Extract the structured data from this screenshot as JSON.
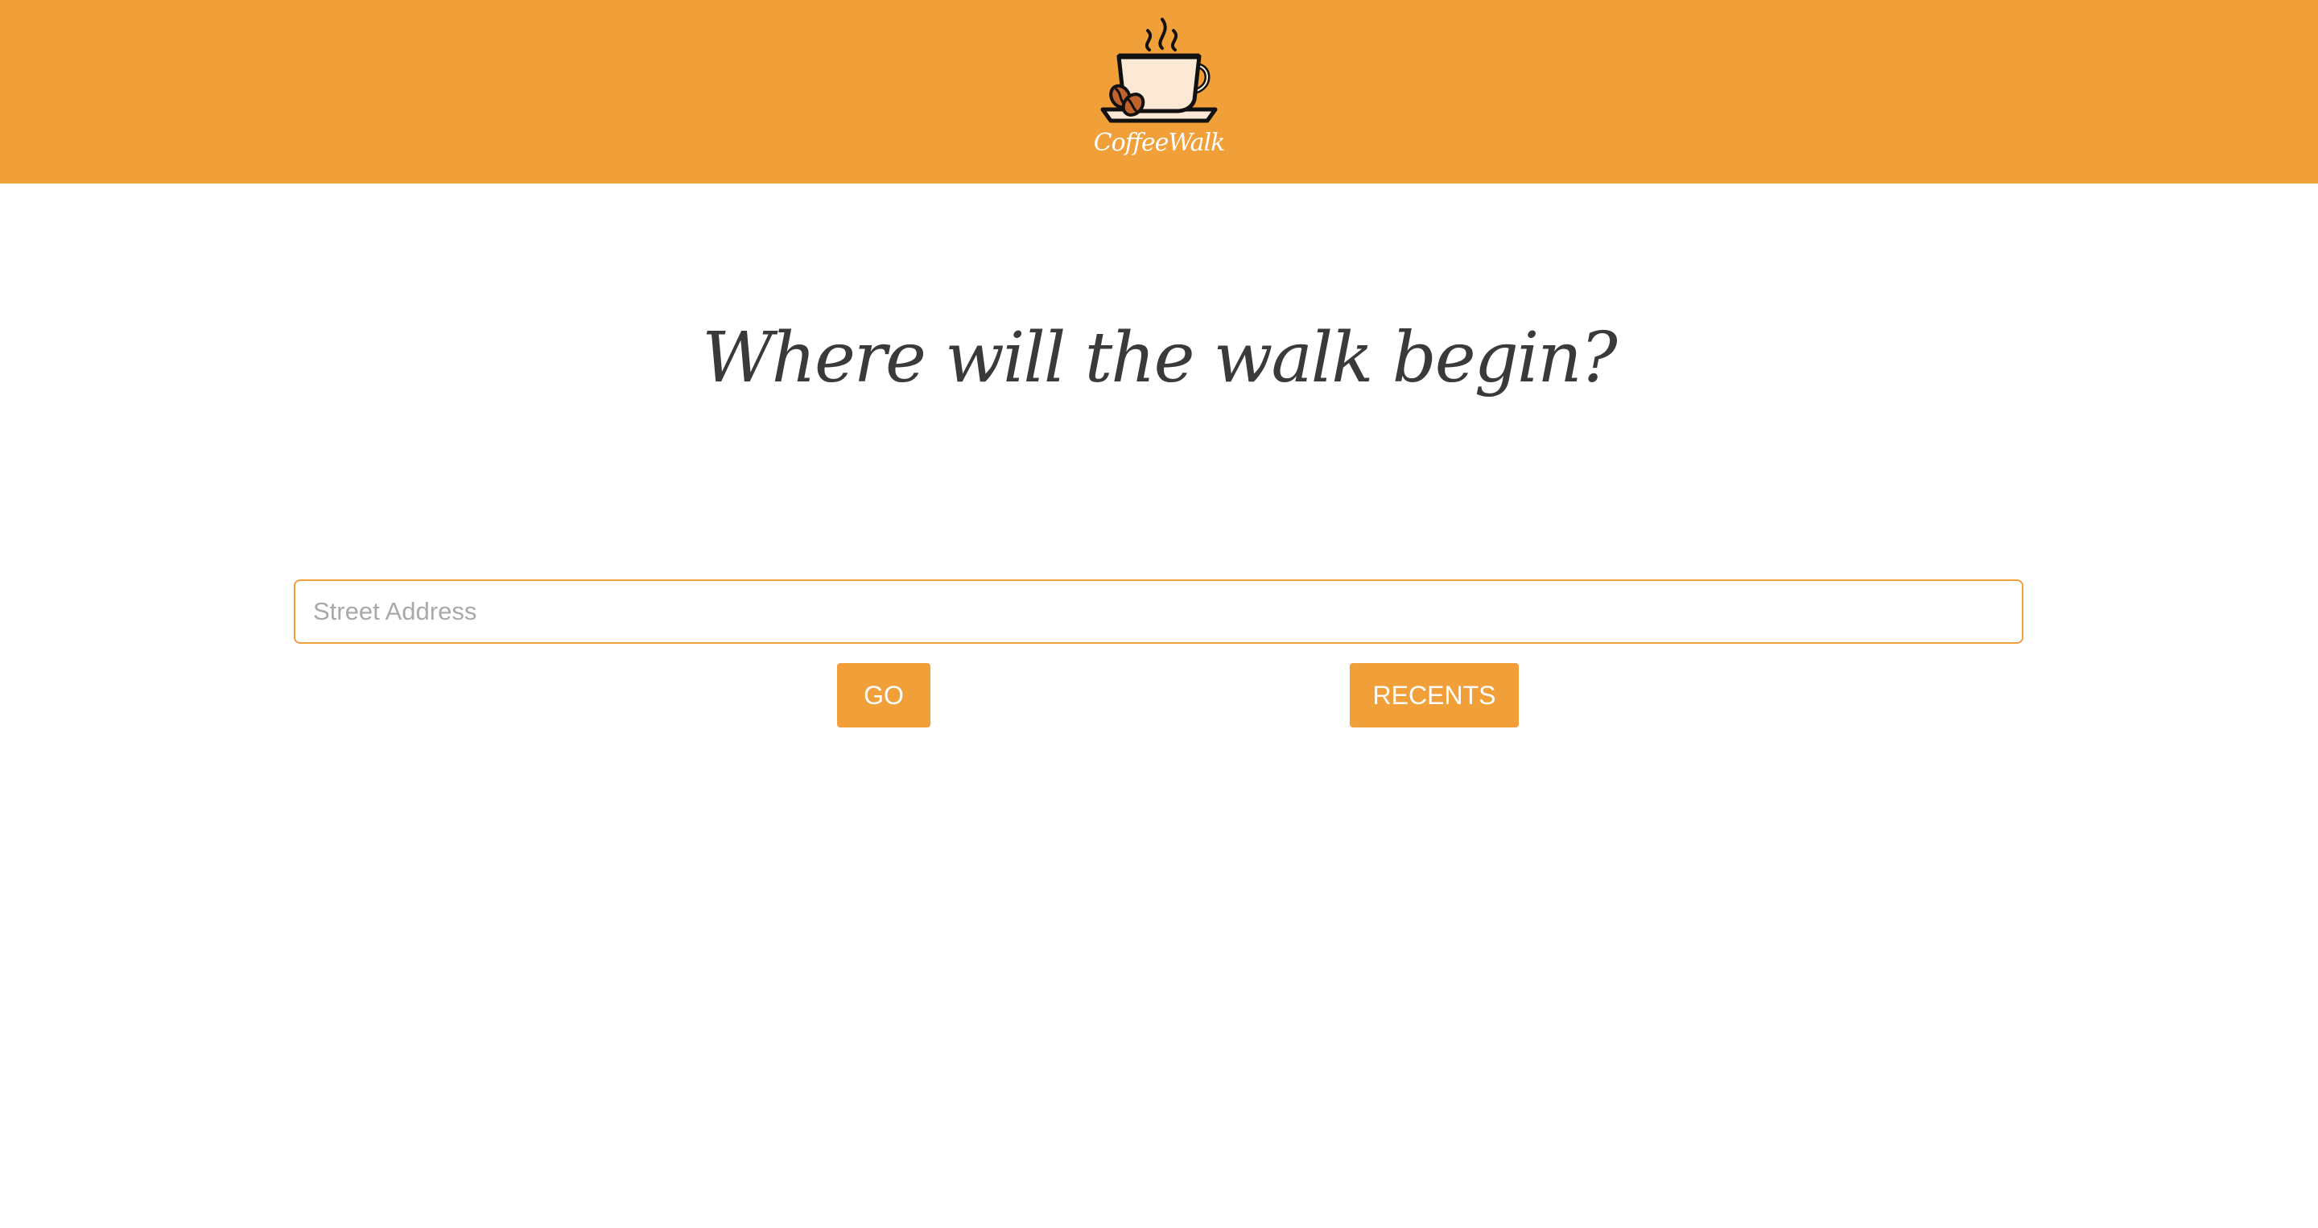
{
  "header": {
    "brand_name": "CoffeeWalk",
    "logo_icon": "coffee-cup-icon",
    "background_color": "#F19F38"
  },
  "main": {
    "headline": "Where will the walk begin?",
    "search": {
      "placeholder": "Street Address",
      "value": ""
    },
    "go_label": "GO",
    "recents_label": "RECENTS"
  },
  "colors": {
    "accent": "#F19F38",
    "text": "#3a3a3a",
    "cup_fill": "#FBE9D6",
    "bean": "#C0622B"
  }
}
